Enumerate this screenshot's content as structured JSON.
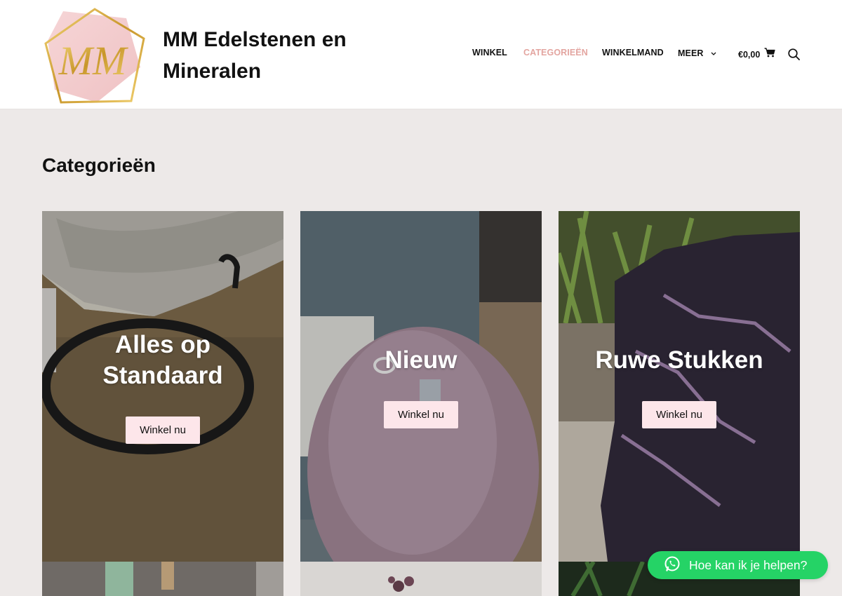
{
  "site": {
    "logo_text": "MM",
    "title": "MM Edelstenen en Mineralen"
  },
  "nav": {
    "items": [
      {
        "label": "WINKEL",
        "active": false
      },
      {
        "label": "CATEGORIEËN",
        "active": true
      },
      {
        "label": "WINKELMAND",
        "active": false
      },
      {
        "label": "MEER",
        "active": false,
        "has_dropdown": true
      }
    ],
    "cart_total": "€0,00",
    "icons": {
      "cart": "cart-icon",
      "search": "search-icon",
      "dropdown": "chevron-down-icon"
    }
  },
  "page": {
    "title": "Categorieën"
  },
  "categories": [
    {
      "title": "Alles op Standaard",
      "button": "Winkel nu"
    },
    {
      "title": "Nieuw",
      "button": "Winkel nu"
    },
    {
      "title": "Ruwe Stukken",
      "button": "Winkel nu"
    }
  ],
  "whatsapp": {
    "label": "Hoe kan ik je helpen?",
    "icon": "whatsapp-icon"
  },
  "colors": {
    "accent": "#e3a5a0",
    "button_bg": "#fde6ea",
    "whatsapp": "#25d366",
    "page_bg": "#ede9e8"
  }
}
